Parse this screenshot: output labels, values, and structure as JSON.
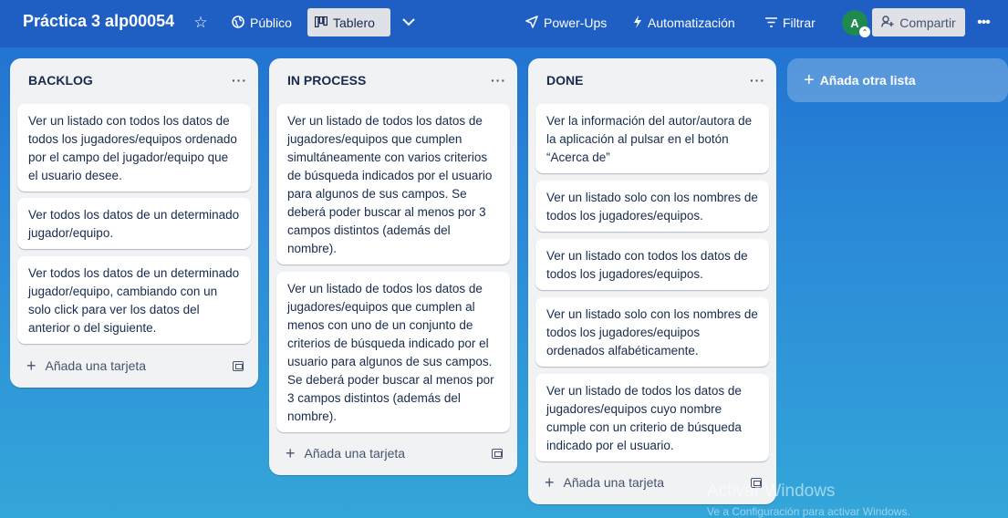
{
  "header": {
    "board_title": "Práctica 3 alp00054",
    "visibility_label": "Público",
    "view_label": "Tablero",
    "powerups_label": "Power-Ups",
    "automation_label": "Automatización",
    "filter_label": "Filtrar",
    "avatar_initial": "A",
    "share_label": "Compartir"
  },
  "lists": [
    {
      "title": "BACKLOG",
      "cards": [
        "Ver un listado con todos los datos de todos los jugadores/equipos ordenado por el campo del jugador/equipo que el usuario desee.",
        "Ver todos los datos de un determinado jugador/equipo.",
        "Ver todos los datos de un determinado jugador/equipo, cambiando con un solo click para ver los datos del anterior o del siguiente."
      ],
      "add_card_label": "Añada una tarjeta"
    },
    {
      "title": "IN PROCESS",
      "cards": [
        "Ver un listado de todos los datos de jugadores/equipos que cumplen simultáneamente con varios criterios de búsqueda indicados por el usuario para algunos de sus campos. Se deberá poder buscar al menos por 3 campos distintos (además del nombre).",
        "Ver un listado de todos los datos de jugadores/equipos que cumplen al menos con uno de un conjunto de criterios de búsqueda indicado por el usuario para algunos de sus campos. Se deberá poder buscar al menos por 3 campos distintos (además del nombre)."
      ],
      "add_card_label": "Añada una tarjeta"
    },
    {
      "title": "DONE",
      "cards": [
        "Ver la información del autor/autora de la aplicación al pulsar en el botón “Acerca de”",
        "Ver un listado solo con los nombres de todos los jugadores/equipos.",
        "Ver un listado con todos los datos de todos los jugadores/equipos.",
        "Ver un listado solo con los nombres de todos los jugadores/equipos ordenados alfabéticamente.",
        "Ver un listado de todos los datos de jugadores/equipos cuyo nombre cumple con un criterio de búsqueda indicado por el usuario."
      ],
      "add_card_label": "Añada una tarjeta"
    }
  ],
  "add_list_label": "Añada otra lista",
  "watermark": {
    "line1": "Activar Windows",
    "line2": "Ve a Configuración para activar Windows."
  }
}
